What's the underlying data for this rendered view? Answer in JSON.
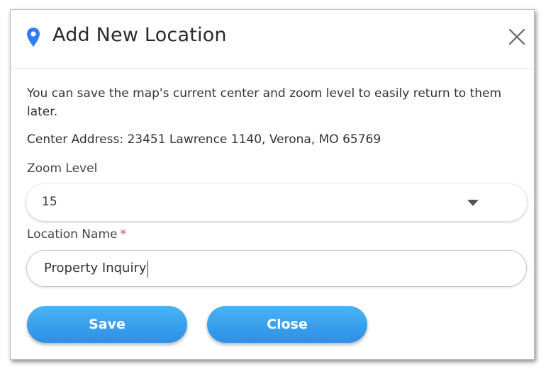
{
  "dialog": {
    "title": "Add New Location",
    "description": "You can save the map's current center and zoom level to easily return to them later.",
    "center_address": "Center Address: 23451 Lawrence 1140, Verona, MO 65769",
    "zoom": {
      "label": "Zoom Level",
      "selected_value": "15"
    },
    "location_name": {
      "label": "Location Name",
      "required_marker": "*",
      "value": "Property Inquiry"
    },
    "buttons": {
      "save_label": "Save",
      "close_label": "Close"
    },
    "icons": {
      "title_icon": "map-pin-icon",
      "close_icon": "close-icon",
      "dropdown_icon": "caret-down-icon"
    },
    "colors": {
      "accent": "#2d8fe6",
      "pin": "#2f7df6",
      "required": "#e53935"
    }
  }
}
